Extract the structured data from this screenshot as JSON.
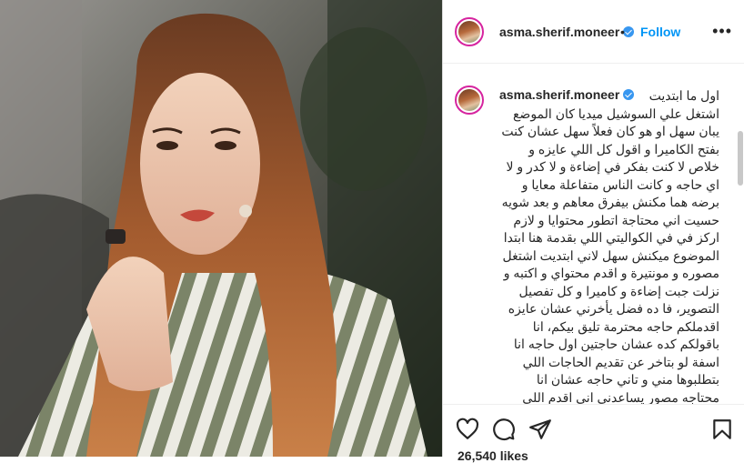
{
  "post": {
    "username": "asma.sherif.moneer",
    "separator": "•",
    "follow_label": "Follow",
    "more_label": "•••",
    "caption": "اول ما ابتديت\nاشتغل علي السوشيل ميديا كان الموضع يبان سهل او هو كان فعلاً سهل عشان كنت بفتح الكاميرا و اقول كل اللي عايزه و خلاص لا كنت بفكر في إضاءة و لا كدر و لا اي حاجه و كانت الناس متفاعلة معايا و برضه هما مكنش بيفرق معاهم و بعد شويه حسيت اني محتاجة اتطور محتوايا و لازم اركز في في الكواليتي اللي بقدمة هنا ابتدا الموضوع ميكنش سهل لاني ابتديت اشتغل مصوره و مونتيرة و اقدم محتواي و اكتبه و نزلت جبت إضاءة و كاميرا و كل تفصيل التصوير، فا ده فضل يأخرني عشان عايزه اقدملكم حاجه محترمة تليق بيكم، انا باقولكم كده عشان حاجتين اول حاجه انا اسفة لو بتاخر عن تقديم الحاجات اللي بتطلبوها مني و تاني حاجه عشان انا محتاجه مصور يساعدني اني اقدم اللي نفسي فيه ، عندي افكار كتير اوي بس تكلفة انفيذ الكونتنت ده كبيرة",
    "likes": "26,540 likes"
  },
  "icons": {
    "verified": "verified-badge-icon",
    "like": "heart-icon",
    "comment": "comment-icon",
    "share": "paper-plane-icon",
    "save": "bookmark-icon"
  },
  "colors": {
    "link": "#0095f6",
    "verified": "#3897f0",
    "text": "#262626"
  }
}
